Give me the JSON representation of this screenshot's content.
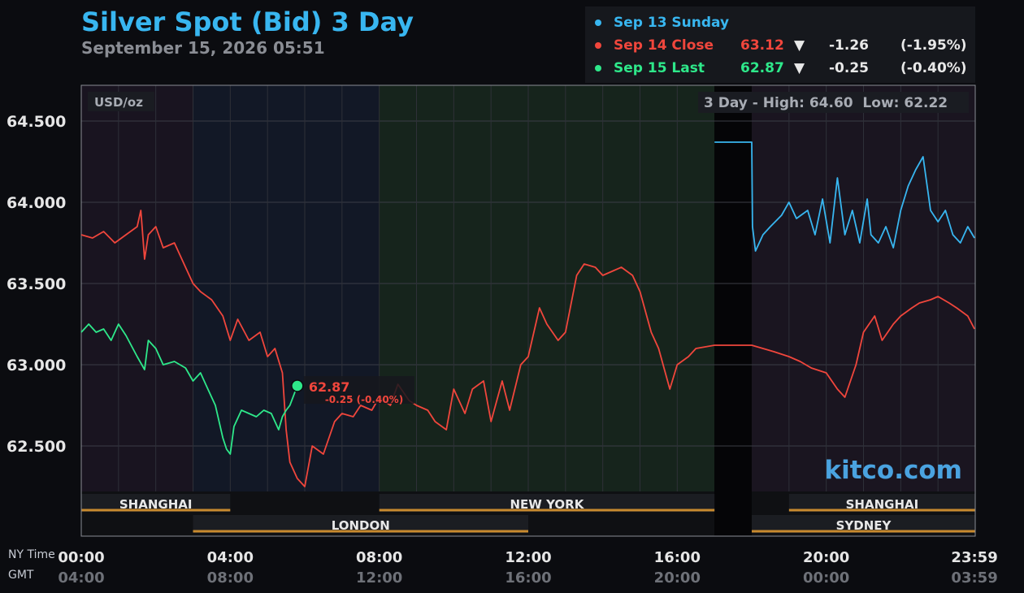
{
  "header": {
    "title": "Silver Spot (Bid) 3 Day",
    "subtitle": "September 15, 2026 05:51"
  },
  "legend": [
    {
      "name": "Sep 13 Sunday",
      "price": "",
      "arrow": "",
      "change": "",
      "pct": "",
      "color": "#38b6f0"
    },
    {
      "name": "Sep 14 Close",
      "price": "63.12",
      "arrow": "▼",
      "change": "-1.26",
      "pct": "(-1.95%)",
      "color": "#f0463c"
    },
    {
      "name": "Sep 15 Last",
      "price": "62.87",
      "arrow": "▼",
      "change": "-0.25",
      "pct": "(-0.40%)",
      "color": "#2ee88a"
    }
  ],
  "labels": {
    "unit": "USD/oz",
    "high_low": "3 Day - High: 64.60  Low: 62.22",
    "watermark": "kitco.com",
    "ny_time": "NY Time",
    "gmt": "GMT",
    "marker_price": "62.87",
    "marker_change": "-0.25 (-0.40%)"
  },
  "sessions": [
    {
      "name": "SHANGHAI",
      "start": 0,
      "end": 4,
      "row": "top"
    },
    {
      "name": "NEW YORK",
      "start": 8,
      "end": 17,
      "row": "top"
    },
    {
      "name": "SHANGHAI",
      "start": 19,
      "end": 24,
      "row": "top"
    },
    {
      "name": "LONDON",
      "start": 3,
      "end": 12,
      "row": "bottom"
    },
    {
      "name": "SYDNEY",
      "start": 18,
      "end": 24,
      "row": "bottom"
    }
  ],
  "chart_data": {
    "type": "line",
    "title": "Silver Spot (Bid) 3 Day",
    "subtitle": "September 15, 2026 05:51",
    "ylabel": "USD/oz",
    "ylim": [
      62.22,
      64.72
    ],
    "xlim": [
      0,
      24
    ],
    "yticks": [
      64.5,
      64.0,
      63.5,
      63.0,
      62.5
    ],
    "ytick_labels": [
      "64.500",
      "64.000",
      "63.500",
      "63.000",
      "62.500"
    ],
    "xticks_ny": [
      {
        "x": 0,
        "label": "00:00"
      },
      {
        "x": 4,
        "label": "04:00"
      },
      {
        "x": 8,
        "label": "08:00"
      },
      {
        "x": 12,
        "label": "12:00"
      },
      {
        "x": 16,
        "label": "16:00"
      },
      {
        "x": 20,
        "label": "20:00"
      },
      {
        "x": 23.98,
        "label": "23:59"
      }
    ],
    "xticks_gmt": [
      "04:00",
      "08:00",
      "12:00",
      "16:00",
      "20:00",
      "00:00",
      "03:59"
    ],
    "grid": true,
    "high": 64.6,
    "low": 62.22,
    "series": [
      {
        "name": "Sep 13 Sunday",
        "color": "#38b6f0",
        "x": [
          17.0,
          18.0,
          18.02,
          18.1,
          18.3,
          18.5,
          18.8,
          19.0,
          19.2,
          19.5,
          19.7,
          19.9,
          20.1,
          20.3,
          20.5,
          20.7,
          20.9,
          21.1,
          21.2,
          21.4,
          21.6,
          21.8,
          22.0,
          22.2,
          22.4,
          22.6,
          22.8,
          23.0,
          23.2,
          23.4,
          23.6,
          23.8,
          23.98
        ],
        "y": [
          64.37,
          64.37,
          63.85,
          63.7,
          63.8,
          63.85,
          63.92,
          64.0,
          63.9,
          63.95,
          63.8,
          64.02,
          63.75,
          64.15,
          63.8,
          63.95,
          63.75,
          64.02,
          63.8,
          63.75,
          63.85,
          63.72,
          63.95,
          64.1,
          64.2,
          64.28,
          63.95,
          63.88,
          63.95,
          63.8,
          63.75,
          63.85,
          63.78
        ]
      },
      {
        "name": "Sep 14 Close",
        "color": "#f0463c",
        "x": [
          0.0,
          0.3,
          0.6,
          0.9,
          1.2,
          1.5,
          1.6,
          1.7,
          1.8,
          2.0,
          2.2,
          2.5,
          2.8,
          3.0,
          3.2,
          3.5,
          3.8,
          4.0,
          4.2,
          4.5,
          4.8,
          5.0,
          5.2,
          5.4,
          5.5,
          5.6,
          5.8,
          6.0,
          6.2,
          6.5,
          6.8,
          7.0,
          7.3,
          7.5,
          7.8,
          8.0,
          8.3,
          8.5,
          8.8,
          9.0,
          9.3,
          9.5,
          9.8,
          10.0,
          10.3,
          10.5,
          10.8,
          11.0,
          11.3,
          11.5,
          11.8,
          12.0,
          12.3,
          12.5,
          12.8,
          13.0,
          13.3,
          13.5,
          13.8,
          14.0,
          14.3,
          14.5,
          14.8,
          15.0,
          15.3,
          15.5,
          15.8,
          16.0,
          16.3,
          16.5,
          17.0,
          18.0,
          18.3,
          18.6,
          19.0,
          19.3,
          19.6,
          20.0,
          20.3,
          20.5,
          20.8,
          21.0,
          21.3,
          21.5,
          21.8,
          22.0,
          22.3,
          22.5,
          22.8,
          23.0,
          23.3,
          23.5,
          23.8,
          23.98
        ],
        "y": [
          63.8,
          63.78,
          63.82,
          63.75,
          63.8,
          63.85,
          63.95,
          63.65,
          63.8,
          63.85,
          63.72,
          63.75,
          63.6,
          63.5,
          63.45,
          63.4,
          63.3,
          63.15,
          63.28,
          63.15,
          63.2,
          63.05,
          63.1,
          62.95,
          62.6,
          62.4,
          62.3,
          62.25,
          62.5,
          62.45,
          62.65,
          62.7,
          62.68,
          62.75,
          62.72,
          62.8,
          62.75,
          62.88,
          62.78,
          62.75,
          62.72,
          62.65,
          62.6,
          62.85,
          62.7,
          62.85,
          62.9,
          62.65,
          62.9,
          62.72,
          63.0,
          63.05,
          63.35,
          63.25,
          63.15,
          63.2,
          63.55,
          63.62,
          63.6,
          63.55,
          63.58,
          63.6,
          63.55,
          63.45,
          63.2,
          63.1,
          62.85,
          63.0,
          63.05,
          63.1,
          63.12,
          63.12,
          63.1,
          63.08,
          63.05,
          63.02,
          62.98,
          62.95,
          62.85,
          62.8,
          63.0,
          63.2,
          63.3,
          63.15,
          63.25,
          63.3,
          63.35,
          63.38,
          63.4,
          63.42,
          63.38,
          63.35,
          63.3,
          63.22
        ]
      },
      {
        "name": "Sep 15 Last",
        "color": "#2ee88a",
        "x": [
          0.0,
          0.2,
          0.4,
          0.6,
          0.8,
          1.0,
          1.2,
          1.5,
          1.7,
          1.8,
          2.0,
          2.2,
          2.5,
          2.8,
          3.0,
          3.2,
          3.4,
          3.6,
          3.8,
          3.9,
          4.0,
          4.1,
          4.3,
          4.5,
          4.7,
          4.9,
          5.1,
          5.3,
          5.4,
          5.5,
          5.6,
          5.8
        ],
        "y": [
          63.2,
          63.25,
          63.2,
          63.22,
          63.15,
          63.25,
          63.18,
          63.05,
          62.97,
          63.15,
          63.1,
          63.0,
          63.02,
          62.98,
          62.9,
          62.95,
          62.85,
          62.75,
          62.55,
          62.48,
          62.45,
          62.62,
          62.72,
          62.7,
          62.68,
          62.72,
          62.7,
          62.6,
          62.68,
          62.72,
          62.75,
          62.87
        ]
      }
    ],
    "marker": {
      "x": 5.8,
      "y": 62.87,
      "label": "62.87",
      "sublabel": "-0.25 (-0.40%)"
    }
  }
}
